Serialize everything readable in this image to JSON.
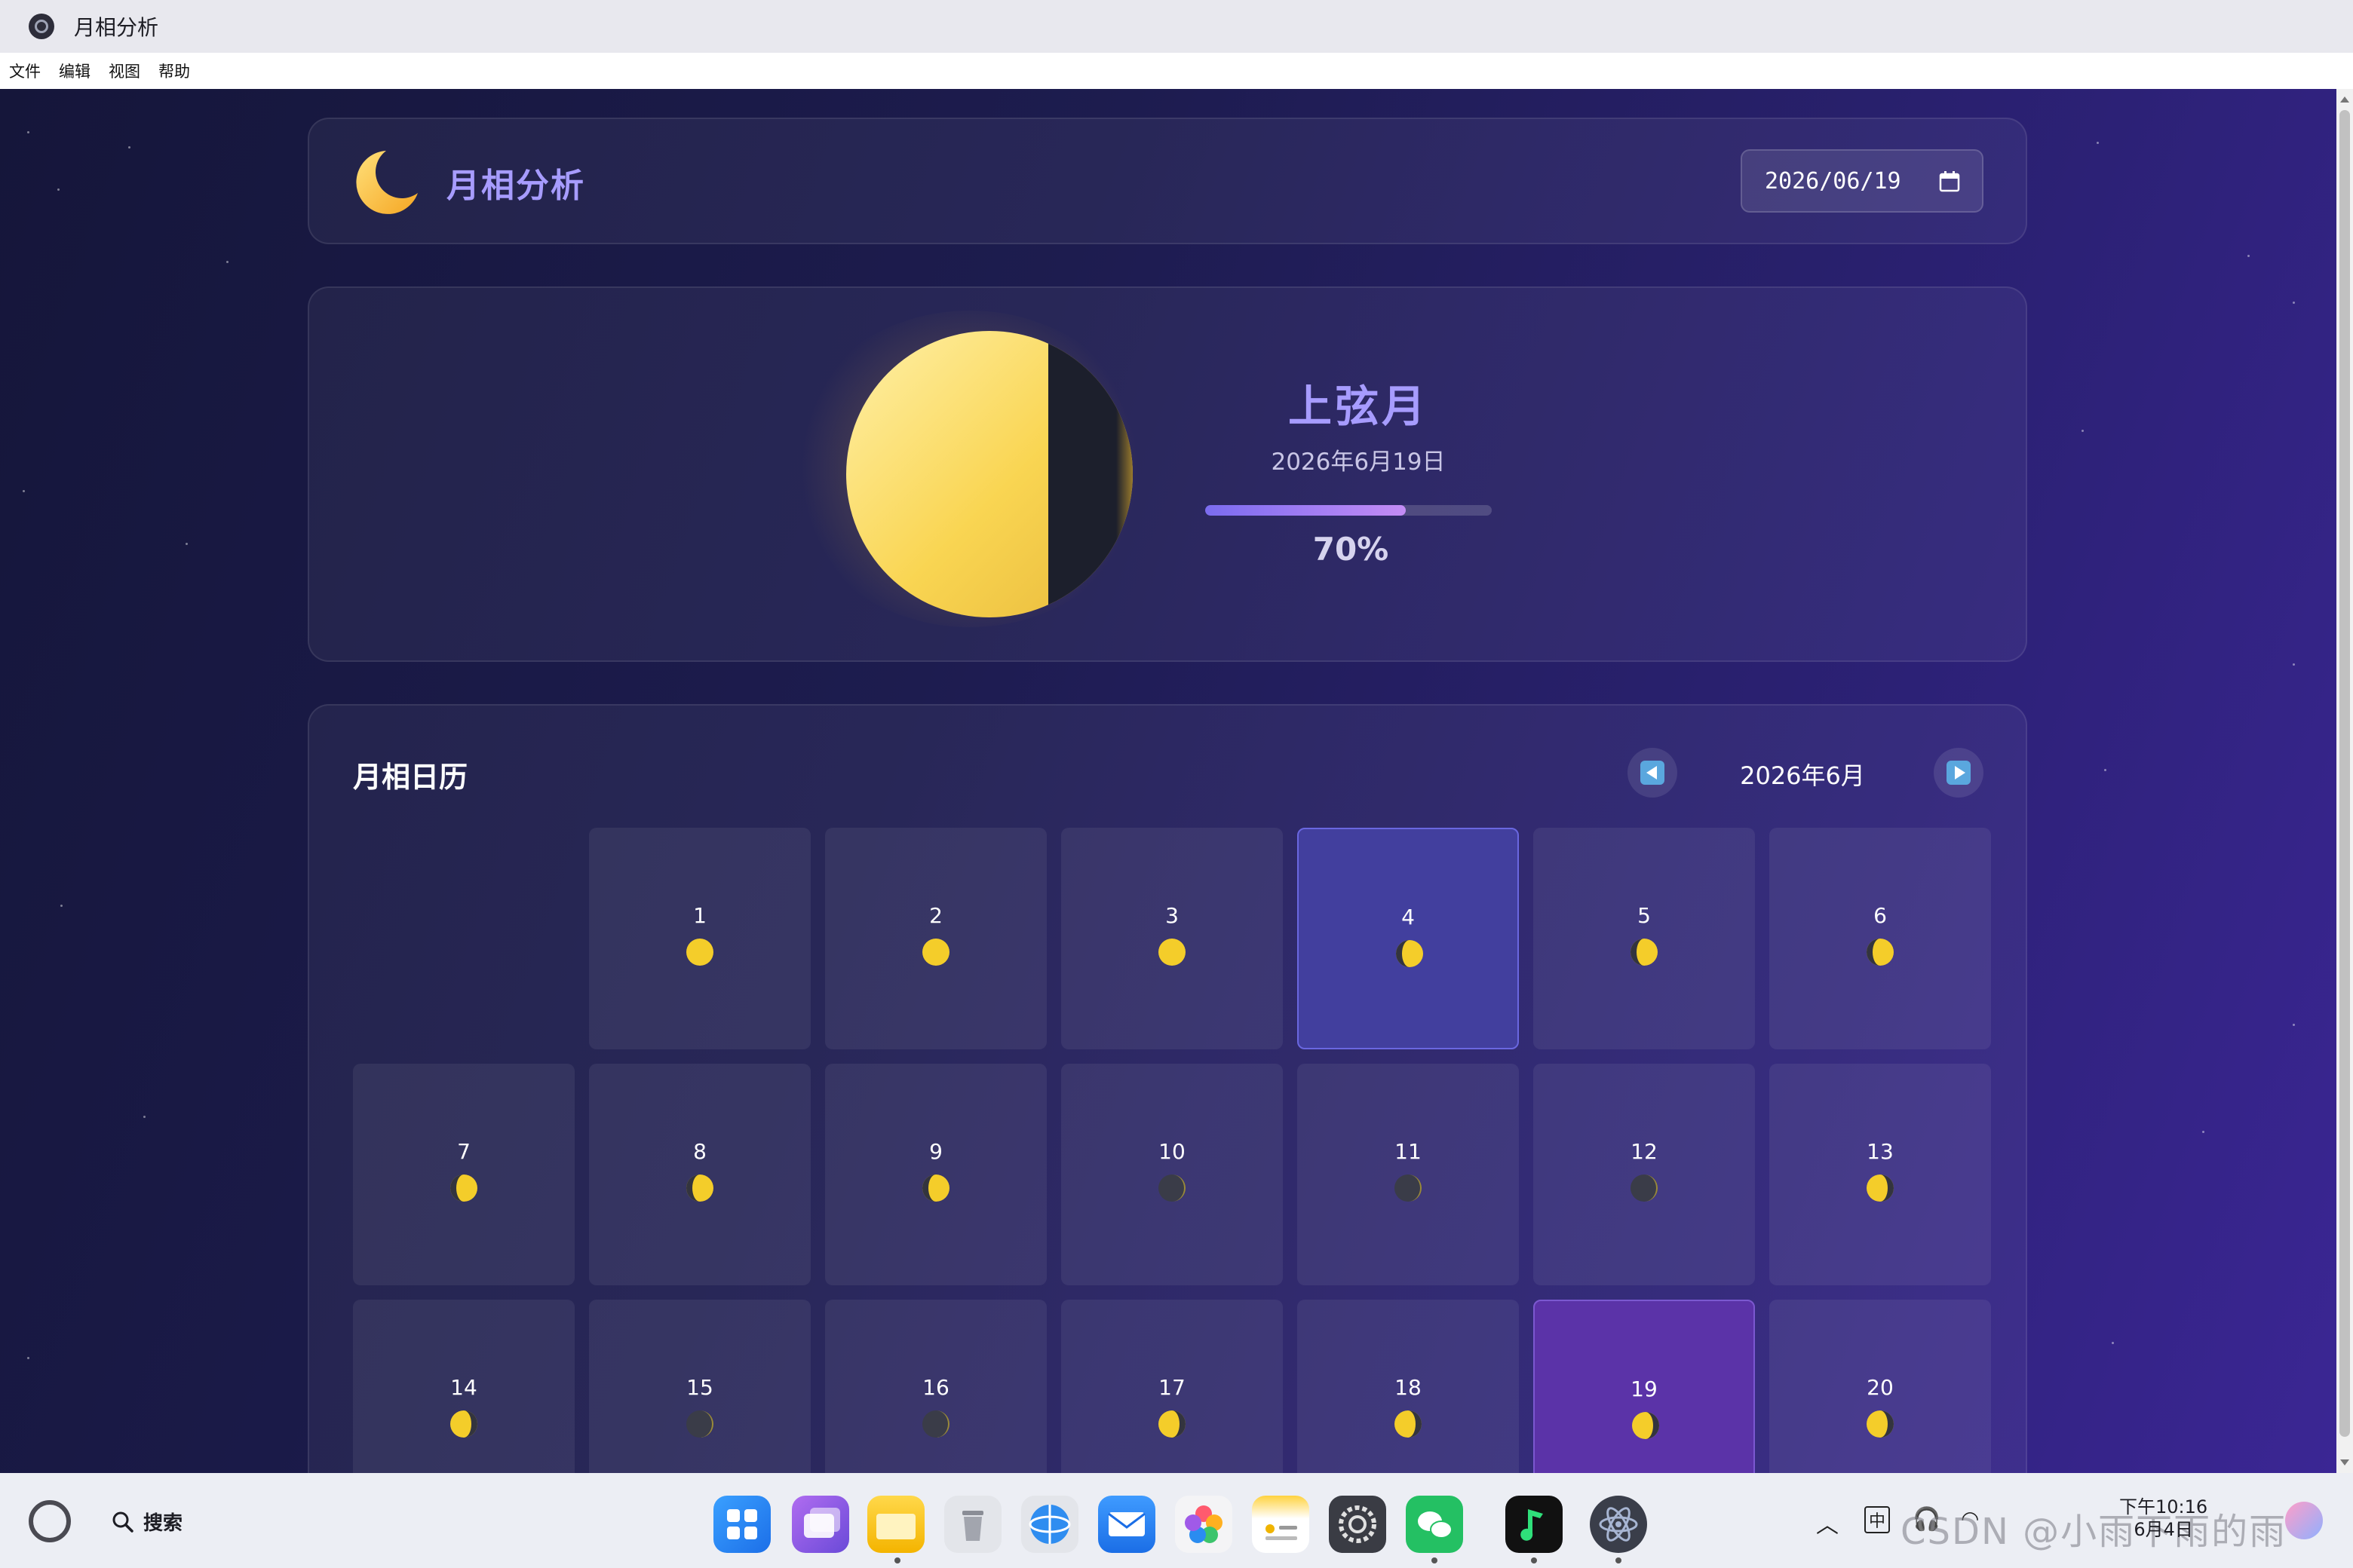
{
  "window": {
    "title": "月相分析"
  },
  "menu": [
    "文件",
    "编辑",
    "视图",
    "帮助"
  ],
  "header": {
    "app_name": "月相分析",
    "date_value": "2026/06/19"
  },
  "phase": {
    "name": "上弦月",
    "date": "2026年6月19日",
    "illumination": 0.7,
    "illumination_label": "70%"
  },
  "calendar": {
    "title": "月相日历",
    "month_label": "2026年6月",
    "first_weekday_offset": 1,
    "selected_day": 4,
    "today": 19,
    "days": [
      {
        "n": "1"
      },
      {
        "n": "2"
      },
      {
        "n": "3"
      },
      {
        "n": "4"
      },
      {
        "n": "5"
      },
      {
        "n": "6"
      },
      {
        "n": "7"
      },
      {
        "n": "8"
      },
      {
        "n": "9"
      },
      {
        "n": "10"
      },
      {
        "n": "11"
      },
      {
        "n": "12"
      },
      {
        "n": "13"
      },
      {
        "n": "14"
      },
      {
        "n": "15"
      },
      {
        "n": "16"
      },
      {
        "n": "17"
      },
      {
        "n": "18"
      },
      {
        "n": "19"
      },
      {
        "n": "20"
      }
    ]
  },
  "colors": {
    "accent": "#a79cff",
    "moon": "#f7d34e",
    "today_bg": "#5b33a8",
    "selected_bg": "#423f9e"
  },
  "taskbar": {
    "search_label": "搜索",
    "apps": [
      "app-grid-icon",
      "multitask-icon",
      "files-icon",
      "trash-icon",
      "browser-icon",
      "mail-icon",
      "photos-icon",
      "notes-icon",
      "settings-icon",
      "wechat-icon",
      "music-icon",
      "electron-icon"
    ],
    "tray": {
      "ime": "中",
      "time": "下午10:16",
      "date": "6月4日"
    },
    "watermark": "CSDN @小雨下雨的雨"
  }
}
